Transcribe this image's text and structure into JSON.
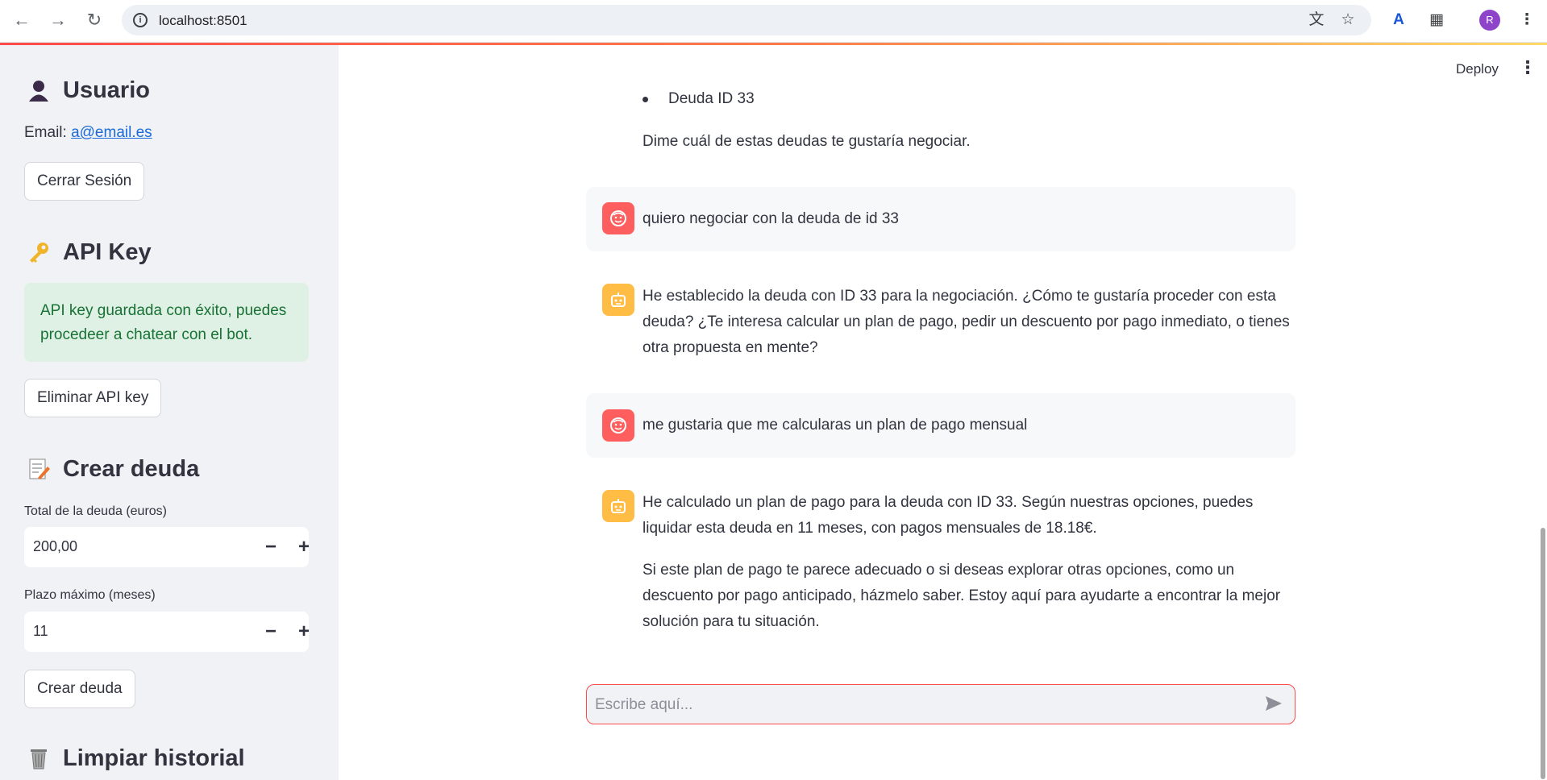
{
  "browser": {
    "url": "localhost:8501",
    "profile_initial": "R"
  },
  "header": {
    "deploy_label": "Deploy"
  },
  "sidebar": {
    "user_section": {
      "title": "Usuario",
      "email_label": "Email: ",
      "email_value": "a@email.es",
      "logout_label": "Cerrar Sesión"
    },
    "api_section": {
      "title": "API Key",
      "success_message": "API key guardada con éxito, puedes procedeer a chatear con el bot.",
      "delete_label": "Eliminar API key"
    },
    "debt_section": {
      "title": "Crear deuda",
      "total_label": "Total de la deuda (euros)",
      "total_value": "200,00",
      "term_label": "Plazo máximo (meses)",
      "term_value": "11",
      "create_label": "Crear deuda"
    },
    "history_section": {
      "title": "Limpiar historial"
    }
  },
  "chat": {
    "bullet_item": "Deuda ID 33",
    "prev_text": "Dime cuál de estas deudas te gustaría negociar.",
    "messages": [
      {
        "role": "user",
        "text": "quiero negociar con la deuda de id 33"
      },
      {
        "role": "assistant",
        "text": "He establecido la deuda con ID 33 para la negociación. ¿Cómo te gustaría proceder con esta deuda? ¿Te interesa calcular un plan de pago, pedir un descuento por pago inmediato, o tienes otra propuesta en mente?"
      },
      {
        "role": "user",
        "text": "me gustaria que me calcularas un plan de pago mensual"
      },
      {
        "role": "assistant",
        "text": "He calculado un plan de pago para la deuda con ID 33. Según nuestras opciones, puedes liquidar esta deuda en 11 meses, con pagos mensuales de 18.18€.",
        "text2": "Si este plan de pago te parece adecuado o si deseas explorar otras opciones, como un descuento por pago anticipado, házmelo saber. Estoy aquí para ayudarte a encontrar la mejor solución para tu situación."
      }
    ],
    "input_placeholder": "Escribe aquí..."
  }
}
